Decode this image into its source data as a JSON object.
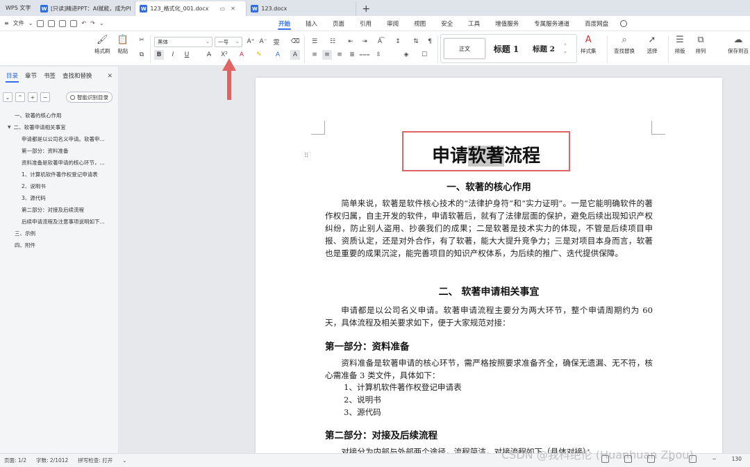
{
  "tabs": {
    "app": "WPS 文字",
    "docs": [
      {
        "label": "[只读]精进PPT：AI赋能，成为PPT高手",
        "active": false
      },
      {
        "label": "123_格式化_001.docx",
        "active": true
      },
      {
        "label": "123.docx",
        "active": false
      }
    ],
    "new_tab": "+"
  },
  "menu": {
    "file_label": "文件",
    "items": [
      "开始",
      "插入",
      "页面",
      "引用",
      "审阅",
      "视图",
      "安全",
      "工具",
      "增值服务",
      "专属服务通道",
      "百度网盘"
    ],
    "active": "开始"
  },
  "ribbon": {
    "format_painter": "格式刷",
    "paste": "粘贴",
    "font_name": "黑体",
    "font_size": "一号",
    "styles": {
      "normal": "正文",
      "h1": "标题  1",
      "h2": "标题  2"
    },
    "style_set": "样式集",
    "find_replace": "查找替换",
    "select": "选择",
    "layout": "排版",
    "arrange": "排列",
    "save_to": "保存到百"
  },
  "nav_panel": {
    "tabs": [
      "目录",
      "章节",
      "书签",
      "查找和替换"
    ],
    "active_tab": "目录",
    "smart_toc": "智能识别目录",
    "items": [
      {
        "label": "一、软著的核心作用",
        "level": 1,
        "expanded": false
      },
      {
        "label": "二、软著申请相关事宜",
        "level": 1,
        "expanded": true
      },
      {
        "label": "申请都是以公司名义申请。软著申...",
        "level": 2
      },
      {
        "label": "第一部分：资料准备",
        "level": 2
      },
      {
        "label": "资料准备是软著申请的核心环节，...",
        "level": 2
      },
      {
        "label": "1、计算机软件著作权登记申请表",
        "level": 2
      },
      {
        "label": "2、说明书",
        "level": 2
      },
      {
        "label": "3、源代码",
        "level": 2
      },
      {
        "label": "第二部分：对接及后续流程",
        "level": 2
      },
      {
        "label": "后续申请流程及注意事项说明如下...",
        "level": 2
      },
      {
        "label": "三、示例",
        "level": 1
      },
      {
        "label": "四、附件",
        "level": 1
      }
    ]
  },
  "document": {
    "title_pre": "申请",
    "title_hl": "软著",
    "title_post": "流程",
    "h1_1": "一、软著的核心作用",
    "p1": "简单来说，软著是软件核心技术的“法律护身符”和“实力证明”。一是它能明确软件的著作权归属，自主开发的软件，申请软著后，就有了法律层面的保护，避免后续出现知识产权纠纷，防止别人盗用、抄袭我们的成果；二是软著是技术实力的体现，不管是后续项目申报、资质认定，还是对外合作，有了软著，能大大提升竞争力；三是对项目本身而言，软著也是重要的成果沉淀，能完善项目的知识产权体系，为后续的推广、迭代提供保障。",
    "h1_2": "二、  软著申请相关事宜",
    "p2": "申请都是以公司名义申请。软著申请流程主要分为两大环节，整个申请周期约为 60 天，具体流程及相关要求如下，便于大家规范对接：",
    "sec1": "第一部分：资料准备",
    "p3": "资料准备是软著申请的核心环节，需严格按照要求准备齐全，确保无遗漏、无不符，核心需准备 3 类文件，具体如下：",
    "list": [
      "1、计算机软件著作权登记申请表",
      "2、说明书",
      "3、源代码"
    ],
    "sec2": "第二部分：对接及后续流程",
    "p4": "对接分为内部与外部两个途径，流程简洁，对接流程如下（具体对接）："
  },
  "statusbar": {
    "page": "页面: 1/2",
    "words": "字数: 2/1012",
    "spell": "拼写检查: 打开",
    "zoom": "130"
  },
  "watermark": "CSDN @我科绝伦 (Huanhuan Zhou)",
  "colors": {
    "accent": "#2f6ce5",
    "annotation": "#e06464"
  }
}
